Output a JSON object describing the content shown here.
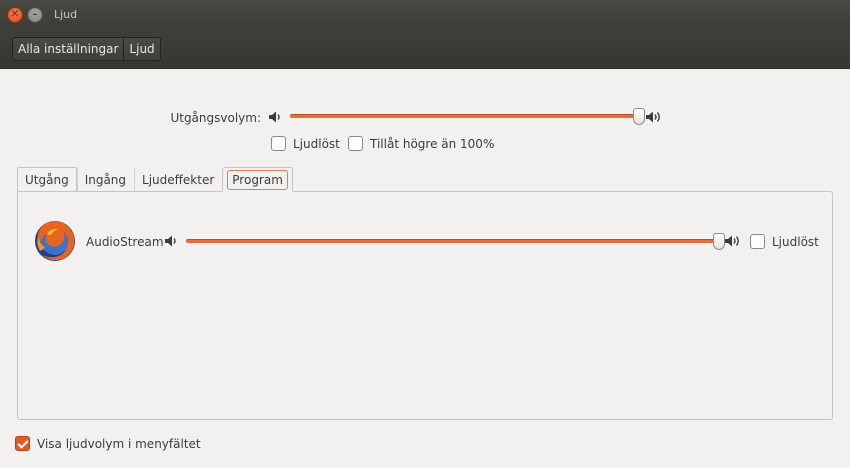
{
  "window": {
    "title": "Ljud"
  },
  "icons": {
    "close": "close-icon",
    "minimize": "minimize-icon",
    "speaker_low": "speaker-low-icon",
    "speaker_high": "speaker-high-icon",
    "app": "firefox-icon"
  },
  "toolbar": {
    "breadcrumbs": [
      "Alla inställningar",
      "Ljud"
    ]
  },
  "output": {
    "label": "Utgångsvolym:",
    "volume": 1.0,
    "mute_label": "Ljudlöst",
    "mute_checked": false,
    "overamp_label": "Tillåt högre än 100%",
    "overamp_checked": false
  },
  "tabs": [
    {
      "label": "Utgång",
      "active": false
    },
    {
      "label": "Ingång",
      "active": false
    },
    {
      "label": "Ljudeffekter",
      "active": false
    },
    {
      "label": "Program",
      "active": true
    }
  ],
  "programs": [
    {
      "name": "AudioStream",
      "volume": 1.0,
      "mute_label": "Ljudlöst",
      "mute_checked": false
    }
  ],
  "footer": {
    "show_volume_label": "Visa ljudvolym i menyfältet",
    "show_volume_checked": true
  },
  "colors": {
    "accent": "#e16f3f",
    "titlebar": "#3c3b37",
    "close_button": "#df4a16"
  }
}
